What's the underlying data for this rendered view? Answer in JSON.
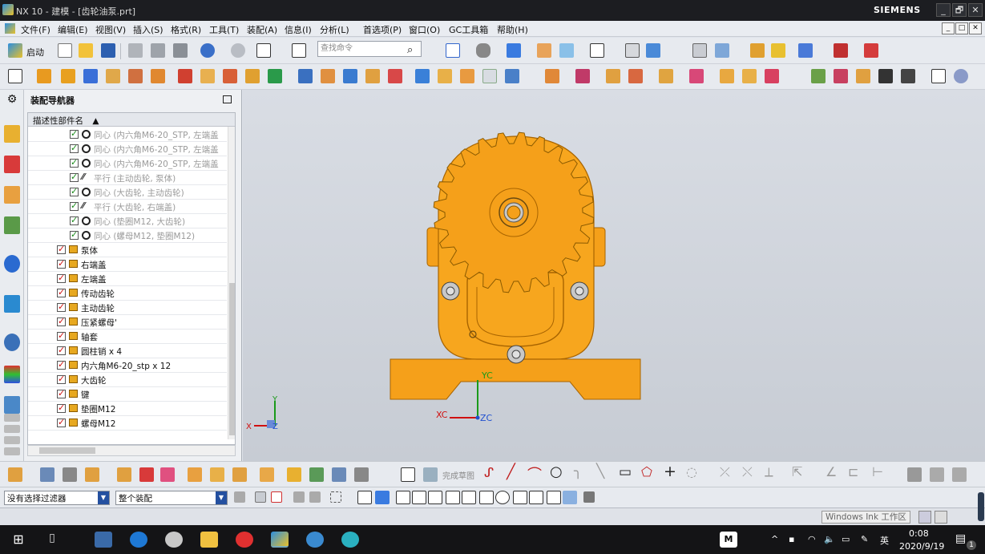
{
  "window": {
    "title": "NX 10 - 建模 - [齿轮油泵.prt]",
    "brand": "SIEMENS",
    "controls": [
      "_",
      "🗗",
      "✕"
    ]
  },
  "menu": {
    "items": [
      "文件(F)",
      "编辑(E)",
      "视图(V)",
      "插入(S)",
      "格式(R)",
      "工具(T)",
      "装配(A)",
      "信息(I)",
      "分析(L)",
      "首选项(P)",
      "窗口(O)",
      "GC工具箱",
      "帮助(H)"
    ]
  },
  "toolbar": {
    "start_label": "启动",
    "search_placeholder": "查找命令"
  },
  "navigator": {
    "title": "装配导航器",
    "column_header": "描述性部件名",
    "rows": [
      {
        "label": "同心 (内六角M6-20_STP, 左端盖",
        "icon": "concentric",
        "dim": true,
        "level": 2
      },
      {
        "label": "同心 (内六角M6-20_STP, 左端盖",
        "icon": "concentric",
        "dim": true,
        "level": 2
      },
      {
        "label": "同心 (内六角M6-20_STP, 左端盖",
        "icon": "concentric",
        "dim": true,
        "level": 2
      },
      {
        "label": "平行 (主动齿轮, 泵体)",
        "icon": "parallel",
        "dim": true,
        "level": 2
      },
      {
        "label": "同心 (大齿轮, 主动齿轮)",
        "icon": "concentric",
        "dim": true,
        "level": 2
      },
      {
        "label": "平行 (大齿轮, 右端盖)",
        "icon": "parallel",
        "dim": true,
        "level": 2
      },
      {
        "label": "同心 (垫圈M12, 大齿轮)",
        "icon": "concentric",
        "dim": true,
        "level": 2
      },
      {
        "label": "同心 (螺母M12, 垫圈M12)",
        "icon": "concentric",
        "dim": true,
        "level": 2
      },
      {
        "label": "泵体",
        "icon": "part",
        "dim": false,
        "level": 1
      },
      {
        "label": "右端盖",
        "icon": "part",
        "dim": false,
        "level": 1
      },
      {
        "label": "左端盖",
        "icon": "part",
        "dim": false,
        "level": 1
      },
      {
        "label": "传动齿轮",
        "icon": "part",
        "dim": false,
        "level": 1
      },
      {
        "label": "主动齿轮",
        "icon": "part",
        "dim": false,
        "level": 1
      },
      {
        "label": "压紧螺母'",
        "icon": "part",
        "dim": false,
        "level": 1
      },
      {
        "label": "轴套",
        "icon": "part",
        "dim": false,
        "level": 1
      },
      {
        "label": "圆柱销 x 4",
        "icon": "part",
        "dim": false,
        "level": 1
      },
      {
        "label": "内六角M6-20_stp x 12",
        "icon": "part",
        "dim": false,
        "level": 1
      },
      {
        "label": "大齿轮",
        "icon": "part",
        "dim": false,
        "level": 1
      },
      {
        "label": "键",
        "icon": "part",
        "dim": false,
        "level": 1
      },
      {
        "label": "垫圈M12",
        "icon": "part",
        "dim": false,
        "level": 1
      },
      {
        "label": "螺母M12",
        "icon": "part",
        "dim": false,
        "level": 1
      }
    ]
  },
  "viewport": {
    "triad_x": "X",
    "triad_y": "Y",
    "triad_z": "Z",
    "wcs_xc": "XC",
    "wcs_yc": "YC",
    "wcs_zc": "ZC",
    "model_color": "#f5a01a"
  },
  "sketch_toolbar": {
    "finish_sketch": "完成草图"
  },
  "selection_bar": {
    "filter_value": "没有选择过滤器",
    "scope_value": "整个装配"
  },
  "status": {
    "ink_button": "Windows Ink 工作区"
  },
  "taskbar": {
    "input_method": "英",
    "time": "0:08",
    "date": "2020/9/19",
    "notif_count": "1",
    "m_label": "M"
  }
}
